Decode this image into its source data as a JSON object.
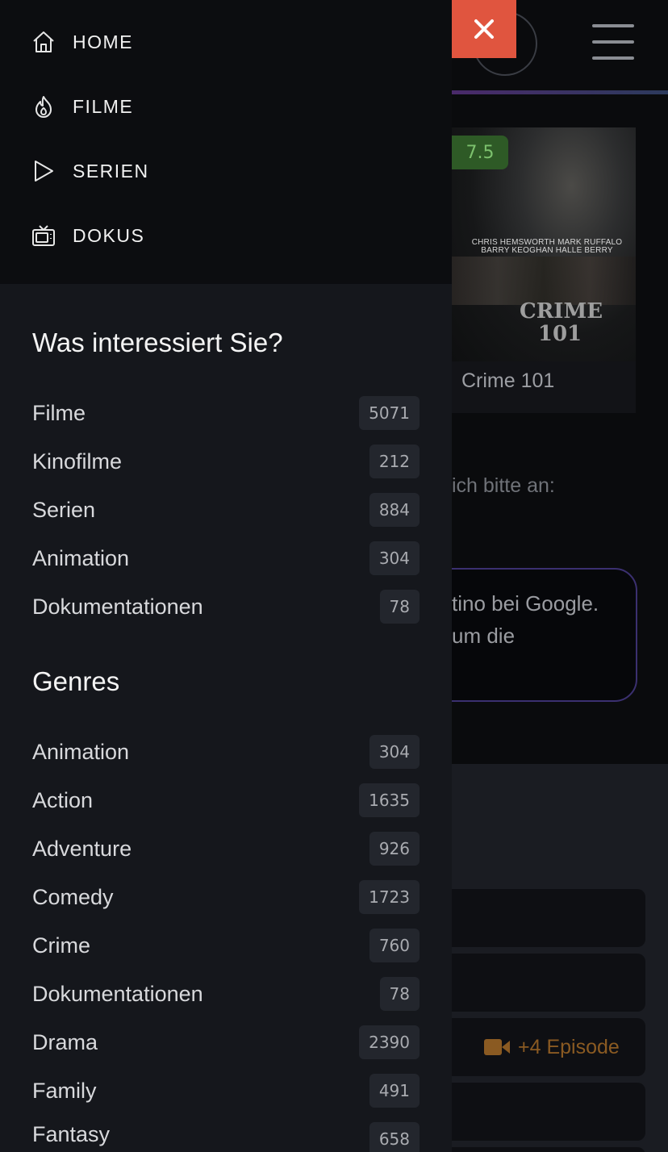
{
  "nav": [
    {
      "label": "HOME",
      "icon": "home-icon"
    },
    {
      "label": "FILME",
      "icon": "fire-icon"
    },
    {
      "label": "SERIEN",
      "icon": "play-icon"
    },
    {
      "label": "DOKUS",
      "icon": "tv-icon"
    }
  ],
  "close_icon": "close-icon",
  "interests": {
    "title": "Was interessiert Sie?",
    "items": [
      {
        "label": "Filme",
        "count": "5071"
      },
      {
        "label": "Kinofilme",
        "count": "212"
      },
      {
        "label": "Serien",
        "count": "884"
      },
      {
        "label": "Animation",
        "count": "304"
      },
      {
        "label": "Dokumentationen",
        "count": "78"
      }
    ]
  },
  "genres": {
    "title": "Genres",
    "items": [
      {
        "label": "Animation",
        "count": "304"
      },
      {
        "label": "Action",
        "count": "1635"
      },
      {
        "label": "Adventure",
        "count": "926"
      },
      {
        "label": "Comedy",
        "count": "1723"
      },
      {
        "label": "Crime",
        "count": "760"
      },
      {
        "label": "Dokumentationen",
        "count": "78"
      },
      {
        "label": "Drama",
        "count": "2390"
      },
      {
        "label": "Family",
        "count": "491"
      },
      {
        "label": "Fantasy",
        "count": "658"
      }
    ]
  },
  "background": {
    "rating": "7.5",
    "poster_title": "Crime 101",
    "poster_cast": "CHRIS HEMSWORTH  MARK RUFFALO  BARRY KEOGHAN  HALLE BERRY",
    "poster_logo": "CRIME 101",
    "partial_text": "ich bitte an:",
    "notice_line1": "tino bei Google.",
    "notice_line2": "um die",
    "episode_badge": "+4 Episode"
  },
  "colors": {
    "close_button": "#e0553f",
    "rating_badge": "#2e5a26",
    "episode_accent": "#8a5a22"
  }
}
